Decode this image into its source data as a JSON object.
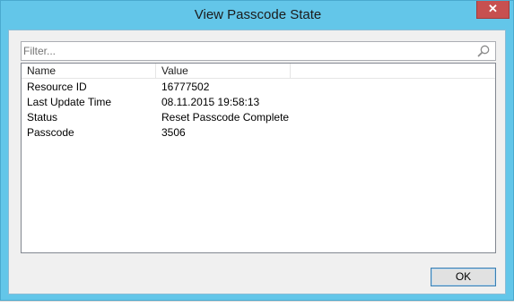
{
  "window": {
    "title": "View Passcode State",
    "close_glyph": "✕"
  },
  "filter": {
    "placeholder": "Filter...",
    "value": "",
    "icon": "search-icon"
  },
  "list": {
    "columns": [
      "Name",
      "Value"
    ],
    "rows": [
      {
        "name": "Resource ID",
        "value": "16777502"
      },
      {
        "name": "Last Update Time",
        "value": "08.11.2015 19:58:13"
      },
      {
        "name": "Status",
        "value": "Reset Passcode Complete"
      },
      {
        "name": "Passcode",
        "value": "3506"
      }
    ]
  },
  "buttons": {
    "ok_label": "OK"
  },
  "colors": {
    "title_bar": "#63c6e9",
    "close_button": "#c75050",
    "ok_border": "#3c7fb1"
  }
}
